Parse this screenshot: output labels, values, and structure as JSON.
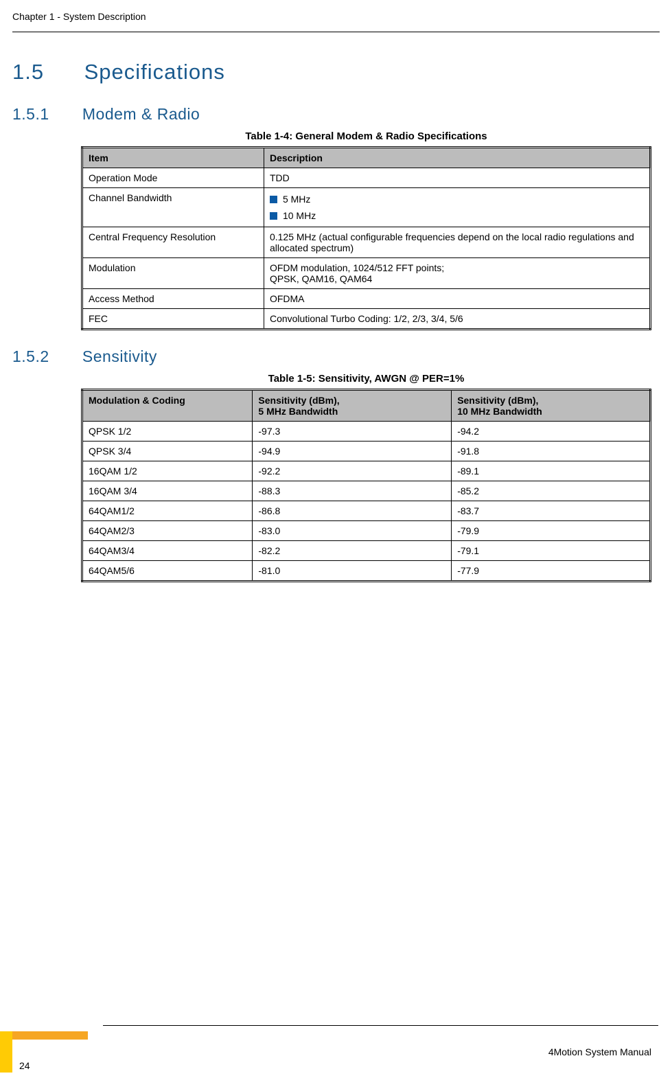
{
  "header": {
    "chapter": "Chapter 1 - System Description"
  },
  "section": {
    "number": "1.5",
    "title": "Specifications"
  },
  "subsection1": {
    "number": "1.5.1",
    "title": "Modem & Radio"
  },
  "table1": {
    "caption": "Table 1-4: General Modem & Radio Specifications",
    "headers": {
      "col1": "Item",
      "col2": "Description"
    },
    "rows": {
      "r1c1": "Operation Mode",
      "r1c2": "TDD",
      "r2c1": "Channel Bandwidth",
      "r2c2a": "5 MHz",
      "r2c2b": "10 MHz",
      "r3c1": "Central Frequency Resolution",
      "r3c2": "0.125 MHz (actual configurable frequencies depend on the local radio regulations and allocated spectrum)",
      "r4c1": "Modulation",
      "r4c2a": "OFDM modulation, 1024/512 FFT points;",
      "r4c2b": "QPSK, QAM16, QAM64",
      "r5c1": "Access Method",
      "r5c2": "OFDMA",
      "r6c1": "FEC",
      "r6c2": "Convolutional Turbo Coding: 1/2, 2/3, 3/4, 5/6"
    }
  },
  "subsection2": {
    "number": "1.5.2",
    "title": "Sensitivity"
  },
  "table2": {
    "caption": "Table 1-5: Sensitivity, AWGN @ PER=1%",
    "headers": {
      "col1": "Modulation & Coding",
      "col2a": "Sensitivity (dBm),",
      "col2b": "5 MHz Bandwidth",
      "col3a": "Sensitivity (dBm),",
      "col3b": "10 MHz Bandwidth"
    },
    "rows": [
      {
        "c1": "QPSK 1/2",
        "c2": "-97.3",
        "c3": "-94.2"
      },
      {
        "c1": "QPSK 3/4",
        "c2": "-94.9",
        "c3": "-91.8"
      },
      {
        "c1": "16QAM 1/2",
        "c2": "-92.2",
        "c3": "-89.1"
      },
      {
        "c1": "16QAM 3/4",
        "c2": "-88.3",
        "c3": "-85.2"
      },
      {
        "c1": "64QAM1/2",
        "c2": "-86.8",
        "c3": "-83.7"
      },
      {
        "c1": "64QAM2/3",
        "c2": "-83.0",
        "c3": "-79.9"
      },
      {
        "c1": "64QAM3/4",
        "c2": "-82.2",
        "c3": "-79.1"
      },
      {
        "c1": "64QAM5/6",
        "c2": "-81.0",
        "c3": "-77.9"
      }
    ]
  },
  "footer": {
    "page": "24",
    "manual": "4Motion System Manual"
  }
}
